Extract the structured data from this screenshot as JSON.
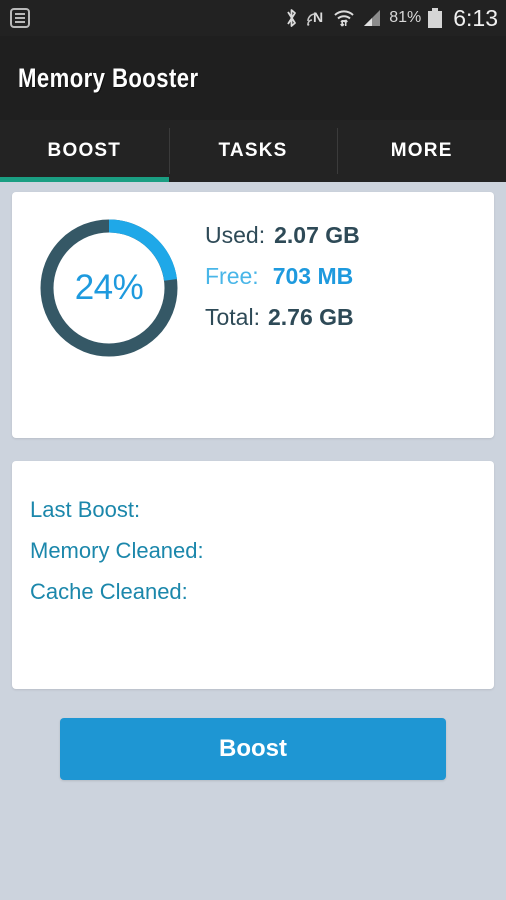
{
  "status_bar": {
    "notification_icon": "list-notification-icon",
    "icons": [
      "bluetooth-icon",
      "nfc-icon",
      "wifi-icon",
      "cellular-signal-icon"
    ],
    "battery_percent": "81%",
    "battery_icon": "battery-icon",
    "time": "6:13"
  },
  "header": {
    "title": "Memory Booster"
  },
  "tabs": [
    {
      "label": "BOOST",
      "active": true
    },
    {
      "label": "TASKS",
      "active": false
    },
    {
      "label": "MORE",
      "active": false
    }
  ],
  "memory": {
    "gauge": {
      "percent_label": "24%",
      "percent_value": 24,
      "track_color": "#355866",
      "arc_color": "#1fa8e8"
    },
    "rows": [
      {
        "label": "Used:",
        "value": "2.07 GB"
      },
      {
        "label": "Free:",
        "value": "703 MB"
      },
      {
        "label": "Total:",
        "value": "2.76 GB"
      }
    ]
  },
  "stats": {
    "rows": [
      {
        "label": "Last Boost:",
        "value": ""
      },
      {
        "label": "Memory Cleaned:",
        "value": ""
      },
      {
        "label": "Cache Cleaned:",
        "value": ""
      }
    ]
  },
  "actions": {
    "boost_label": "Boost"
  },
  "colors": {
    "accent_blue": "#1e96d3",
    "tab_indicator": "#1a9e82",
    "page_background": "#ccd3dd",
    "dark_chrome": "#1f1f1f",
    "stat_text": "#1b87ab",
    "dark_slate": "#2e4a57"
  }
}
